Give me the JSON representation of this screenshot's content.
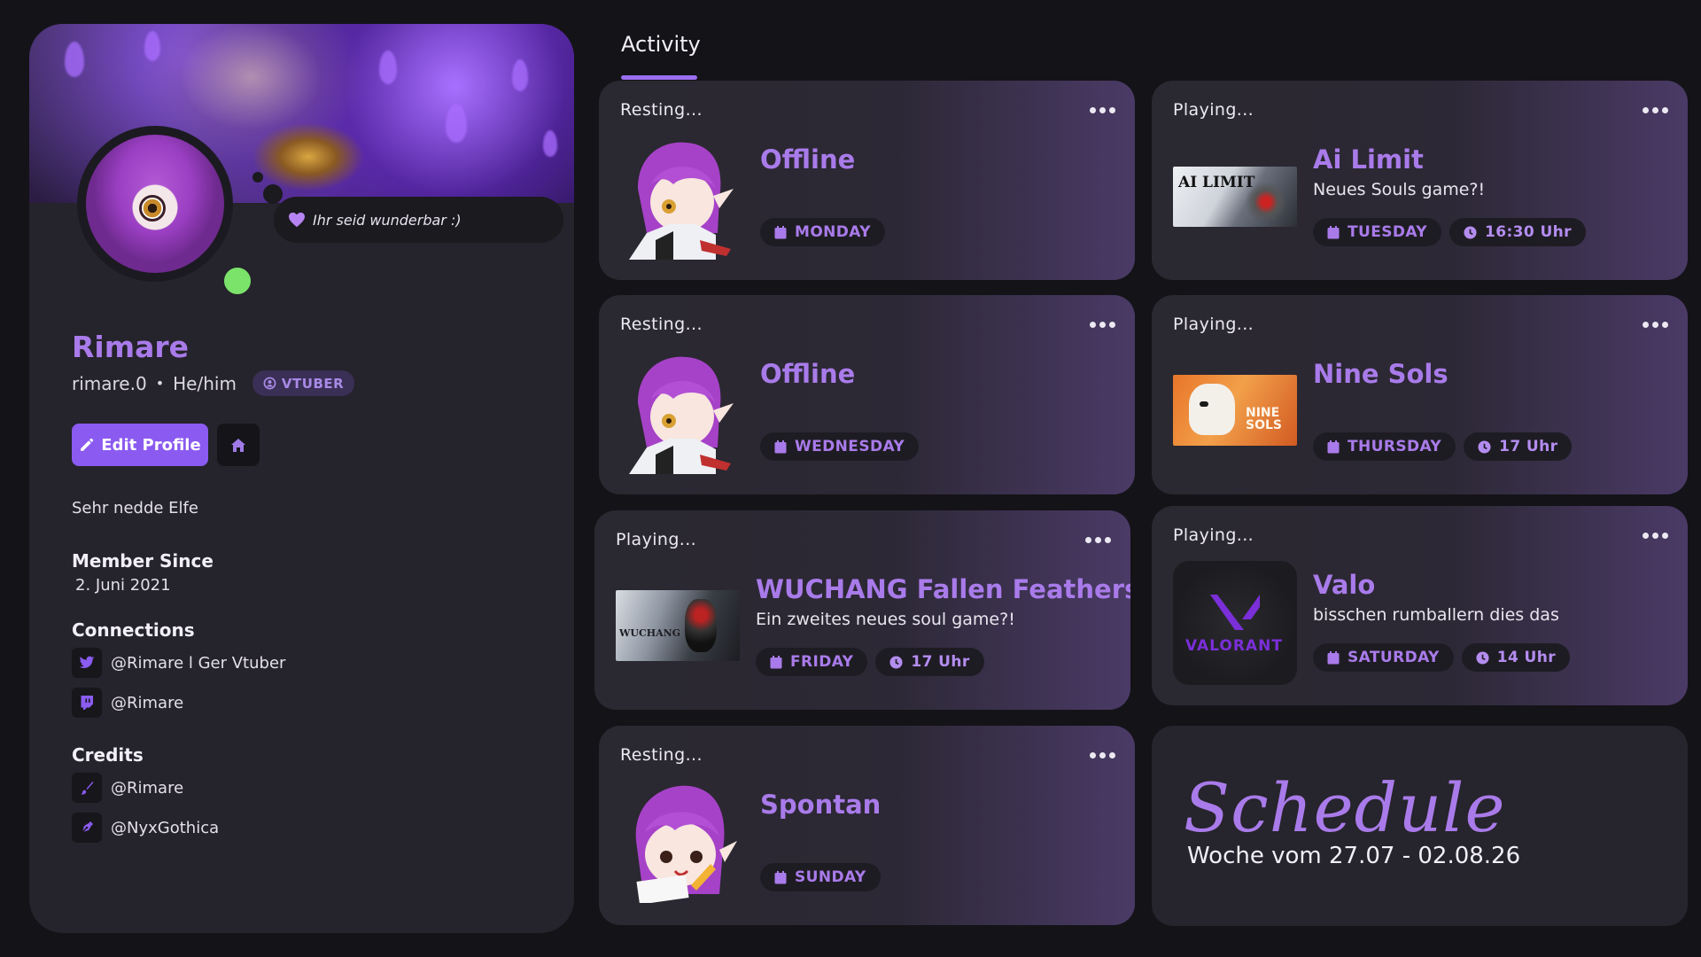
{
  "profile": {
    "bubble_text": "Ihr seid wunderbar :)",
    "name": "Rimare",
    "username": "rimare.0",
    "separator": "•",
    "pronouns": "He/him",
    "badge": "VTUBER",
    "edit_button": "Edit Profile",
    "bio": "Sehr nedde Elfe",
    "member_since_title": "Member Since",
    "member_since_date": "2. Juni 2021",
    "connections_title": "Connections",
    "connections": [
      {
        "icon": "twitter-icon",
        "label": "@Rimare l Ger Vtuber"
      },
      {
        "icon": "twitch-icon",
        "label": "@Rimare"
      }
    ],
    "credits_title": "Credits",
    "credits": [
      {
        "icon": "brush-icon",
        "label": "@Rimare"
      },
      {
        "icon": "pen-icon",
        "label": "@NyxGothica"
      }
    ],
    "online_color": "#7be36a"
  },
  "activity": {
    "tab_label": "Activity",
    "cards": [
      {
        "status": "Resting...",
        "title": "Offline",
        "subtitle": "",
        "day": "MONDAY",
        "time": ""
      },
      {
        "status": "Playing...",
        "title": "Ai Limit",
        "subtitle": "Neues Souls game?!",
        "day": "TUESDAY",
        "time": "16:30 Uhr",
        "thumb_text": "AI LIMIT"
      },
      {
        "status": "Resting...",
        "title": "Offline",
        "subtitle": "",
        "day": "WEDNESDAY",
        "time": ""
      },
      {
        "status": "Playing...",
        "title": "Nine Sols",
        "subtitle": "",
        "day": "THURSDAY",
        "time": "17 Uhr",
        "thumb_text": "NINE SOLS"
      },
      {
        "status": "Playing...",
        "title": "WUCHANG Fallen Feathers",
        "subtitle": "Ein zweites neues soul game?!",
        "day": "FRIDAY",
        "time": "17 Uhr",
        "thumb_text": "WUCHANG"
      },
      {
        "status": "Playing...",
        "title": "Valo",
        "subtitle": "bisschen rumballern dies das",
        "day": "SATURDAY",
        "time": "14  Uhr",
        "thumb_text": "VALORANT"
      },
      {
        "status": "Resting...",
        "title": "Spontan",
        "subtitle": "",
        "day": "SUNDAY",
        "time": ""
      }
    ]
  },
  "schedule": {
    "title": "Schedule",
    "subtitle": "Woche vom 27.07 -  02.08.26"
  },
  "colors": {
    "accent": "#a97bea",
    "button": "#8b5af0",
    "background": "#141318",
    "panel": "#25232b"
  }
}
